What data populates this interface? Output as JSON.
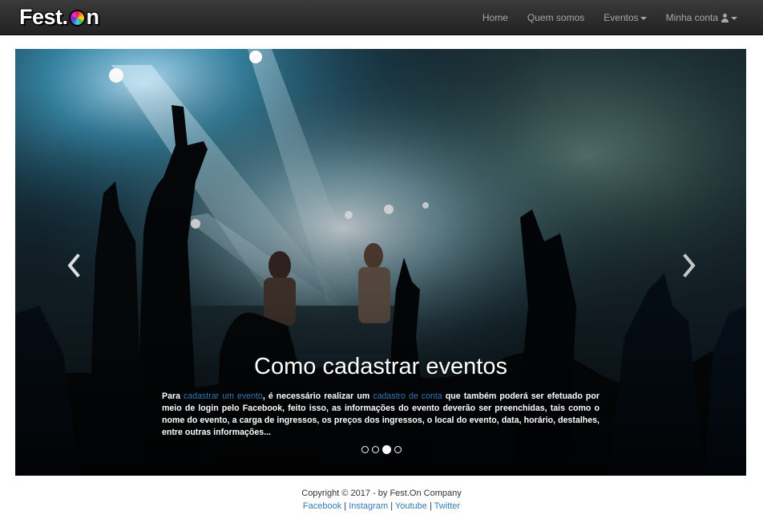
{
  "navbar": {
    "brand_prefix": "Fest.",
    "brand_suffix": "n",
    "items": [
      {
        "label": "Home"
      },
      {
        "label": "Quem somos"
      },
      {
        "label": "Eventos"
      },
      {
        "label": "Minha conta"
      }
    ]
  },
  "carousel": {
    "title": "Como cadastrar eventos",
    "text_1": "Para ",
    "link_1": "cadastrar um evento",
    "text_2": ", é necessário realizar um ",
    "link_2": "cadastro de conta",
    "text_3": " que também poderá ser efetuado por meio de login pelo Facebook, feito isso, as informações do evento deverão ser preenchidas, tais como o nome do evento, a carga de ingressos, os preços dos ingressos, o local do evento, data, horário, destalhes, entre outras informações...",
    "slide_count": 4,
    "active_index": 2,
    "prev_icon": "chevron-left-icon",
    "next_icon": "chevron-right-icon"
  },
  "footer": {
    "copyright": "Copyright © 2017 - by Fest.On Company",
    "links": [
      {
        "label": "Facebook"
      },
      {
        "label": "Instagram"
      },
      {
        "label": "Youtube"
      },
      {
        "label": "Twitter"
      }
    ],
    "separator": "|"
  },
  "colors": {
    "navbar_bg": "#222222",
    "nav_text": "#a8a8a8",
    "link": "#337ab7",
    "caption_text": "#ffffff"
  }
}
